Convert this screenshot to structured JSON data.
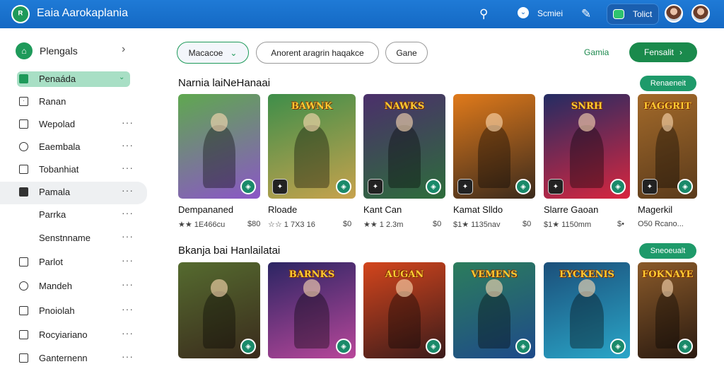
{
  "header": {
    "title": "Eaia Aarokaplania",
    "search_icon": "search-icon",
    "account_label": "Scmiei",
    "pill_label": "Tolict",
    "colors": {
      "bar": "#1469c4",
      "accent": "#1a8a4c"
    }
  },
  "sidebar": {
    "top": {
      "label": "Plengals"
    },
    "items": [
      {
        "label": "Penaáda",
        "icon": "grid-icon"
      },
      {
        "label": "Ranan",
        "icon": "square-icon"
      },
      {
        "label": "Wepolad",
        "icon": "file-icon"
      },
      {
        "label": "Eaembala",
        "icon": "history-icon"
      },
      {
        "label": "Tobanhiat",
        "icon": "doc-icon"
      },
      {
        "label": "Pamala",
        "icon": "flag-icon"
      },
      {
        "label": "Parrka",
        "icon": ""
      },
      {
        "label": "Senstnname",
        "icon": ""
      },
      {
        "label": "Parlot",
        "icon": "box-icon"
      },
      {
        "label": "Mandeh",
        "icon": "clock-icon"
      },
      {
        "label": "Pnoiolah",
        "icon": "edit-icon"
      },
      {
        "label": "Rocyiariano",
        "icon": "chat-icon"
      },
      {
        "label": "Ganternenn",
        "icon": "exit-icon"
      }
    ]
  },
  "filters": {
    "chip1": "Macacoe",
    "chip2": "Anorent aragrin haqakce",
    "chip3": "Gane",
    "link": "Gamia",
    "primary": "Fensalit"
  },
  "section1": {
    "title": "Narnia laiNeHanaai",
    "button": "Renaeneit",
    "cards": [
      {
        "title": "Dempananed",
        "rating": "★★ 1E466cu",
        "price": "$80",
        "logo": "",
        "colors": [
          "#5fa84f",
          "#8b56c7"
        ]
      },
      {
        "title": "Rloade",
        "rating": "☆☆ 1 7X3 16",
        "price": "$0",
        "logo": "BAWNK",
        "colors": [
          "#3e8e4a",
          "#c7a24d"
        ]
      },
      {
        "title": "Kant Can",
        "rating": "★★ 1 2.3m",
        "price": "$0",
        "logo": "NAWKS",
        "colors": [
          "#4b2f6b",
          "#2d6d3b"
        ]
      },
      {
        "title": "Kamat Slldo",
        "rating": "$1★ 1135nav",
        "price": "$0",
        "logo": "",
        "colors": [
          "#e07a1b",
          "#3a2a1c"
        ]
      },
      {
        "title": "Slarre Gaoan",
        "rating": "$1★ 1150mm",
        "price": "$⁠•",
        "logo": "SNRH",
        "colors": [
          "#232c63",
          "#d8263f"
        ]
      },
      {
        "title": "Magerkil",
        "rating": "O50 Rcano...",
        "price": "",
        "logo": "FAGGRIT",
        "colors": [
          "#a36a2a",
          "#5a3a1b"
        ]
      }
    ]
  },
  "section2": {
    "title": "Bkanja bai Hanlailatai",
    "button": "Sneoeualt",
    "cards": [
      {
        "logo": "",
        "colors": [
          "#556b2f",
          "#3a2a1c"
        ]
      },
      {
        "logo": "BARNKS",
        "colors": [
          "#2b2563",
          "#b8479a"
        ]
      },
      {
        "logo": "AUGAN",
        "colors": [
          "#d3451c",
          "#3a1b1b"
        ]
      },
      {
        "logo": "VEMENS",
        "colors": [
          "#2c7d5c",
          "#1e4a8a"
        ]
      },
      {
        "logo": "EYCKENIS",
        "colors": [
          "#1b4f7a",
          "#2aa6c8"
        ]
      },
      {
        "logo": "FOKNAYE",
        "colors": [
          "#8a5a2a",
          "#2a1a10"
        ]
      }
    ]
  }
}
